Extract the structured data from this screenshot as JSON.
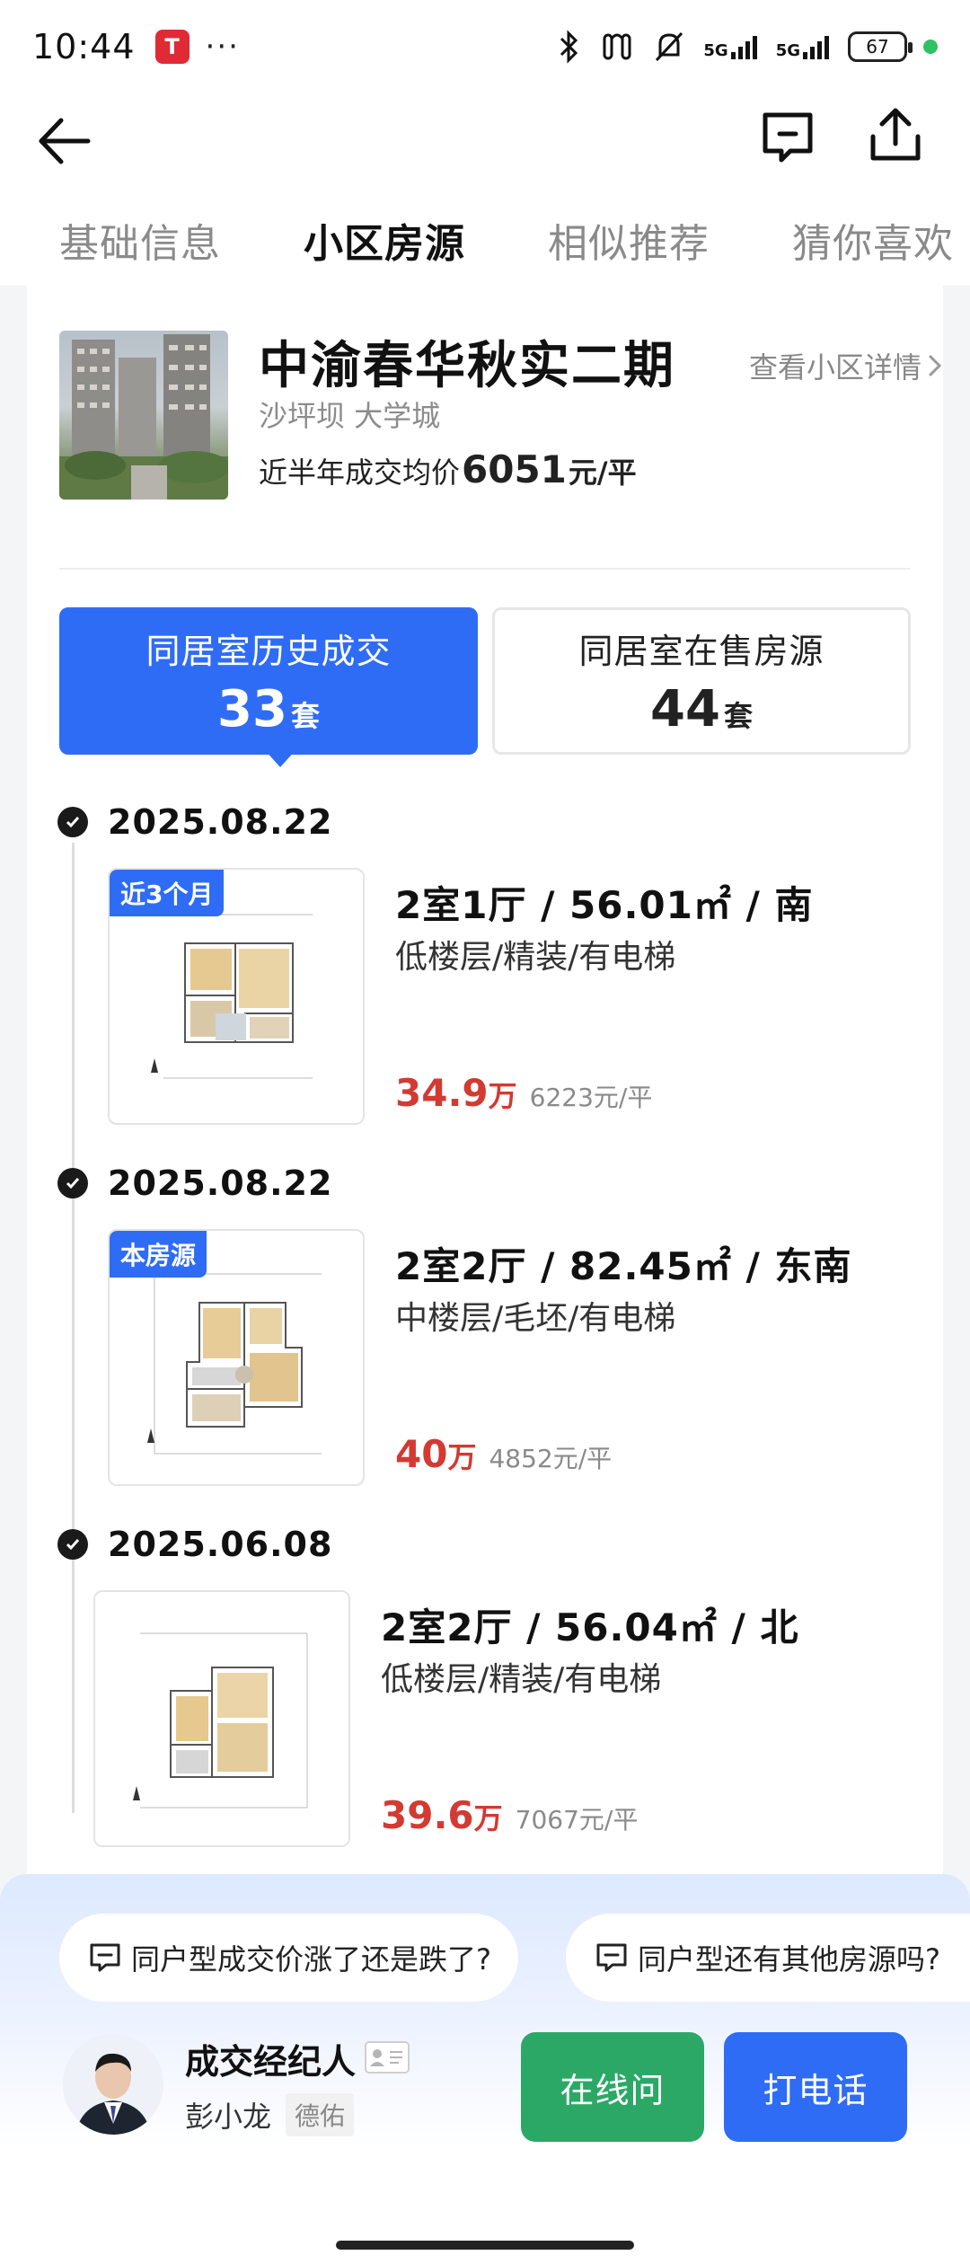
{
  "status_bar": {
    "time": "10:44",
    "app_badge": "T",
    "more": "···",
    "net1": "5G",
    "net2": "5G",
    "battery": "67"
  },
  "header": {
    "back_icon": "arrow-left-icon",
    "chat_icon": "chat-bubble-icon",
    "share_icon": "share-upload-icon"
  },
  "tabs": [
    {
      "label": "基础信息",
      "active": false
    },
    {
      "label": "小区房源",
      "active": true
    },
    {
      "label": "相似推荐",
      "active": false
    },
    {
      "label": "猜你喜欢",
      "active": false
    }
  ],
  "community": {
    "name": "中渝春华秋实二期",
    "area": "沙坪坝 大学城",
    "price_label": "近半年成交均价",
    "price_value": "6051",
    "price_unit": "元/平",
    "view_detail": "查看小区详情"
  },
  "stats": {
    "history": {
      "label": "同居室历史成交",
      "count": "33",
      "unit": "套"
    },
    "on_sale": {
      "label": "同居室在售房源",
      "count": "44",
      "unit": "套"
    }
  },
  "listings": [
    {
      "date": "2025.08.22",
      "tag": "近3个月",
      "title": "2室1厅 / 56.01㎡ / 南",
      "tags": "低楼层/精装/有电梯",
      "total": "34.9",
      "total_unit": "万",
      "unit_price": "6223元/平"
    },
    {
      "date": "2025.08.22",
      "tag": "本房源",
      "title": "2室2厅 / 82.45㎡ / 东南",
      "tags": "中楼层/毛坯/有电梯",
      "total": "40",
      "total_unit": "万",
      "unit_price": "4852元/平"
    },
    {
      "date": "2025.06.08",
      "tag": "",
      "title": "2室2厅 / 56.04㎡ / 北",
      "tags": "低楼层/精装/有电梯",
      "total": "39.6",
      "total_unit": "万",
      "unit_price": "7067元/平"
    }
  ],
  "bottom": {
    "question1": "同户型成交价涨了还是跌了?",
    "question2": "同户型还有其他房源吗?",
    "agent_title": "成交经纪人",
    "agent_name": "彭小龙",
    "agent_company": "德佑",
    "btn_online": "在线问",
    "btn_call": "打电话"
  },
  "colors": {
    "accent_blue": "#2f6cf6",
    "price_red": "#d23a32",
    "call_green": "#2ca866"
  }
}
